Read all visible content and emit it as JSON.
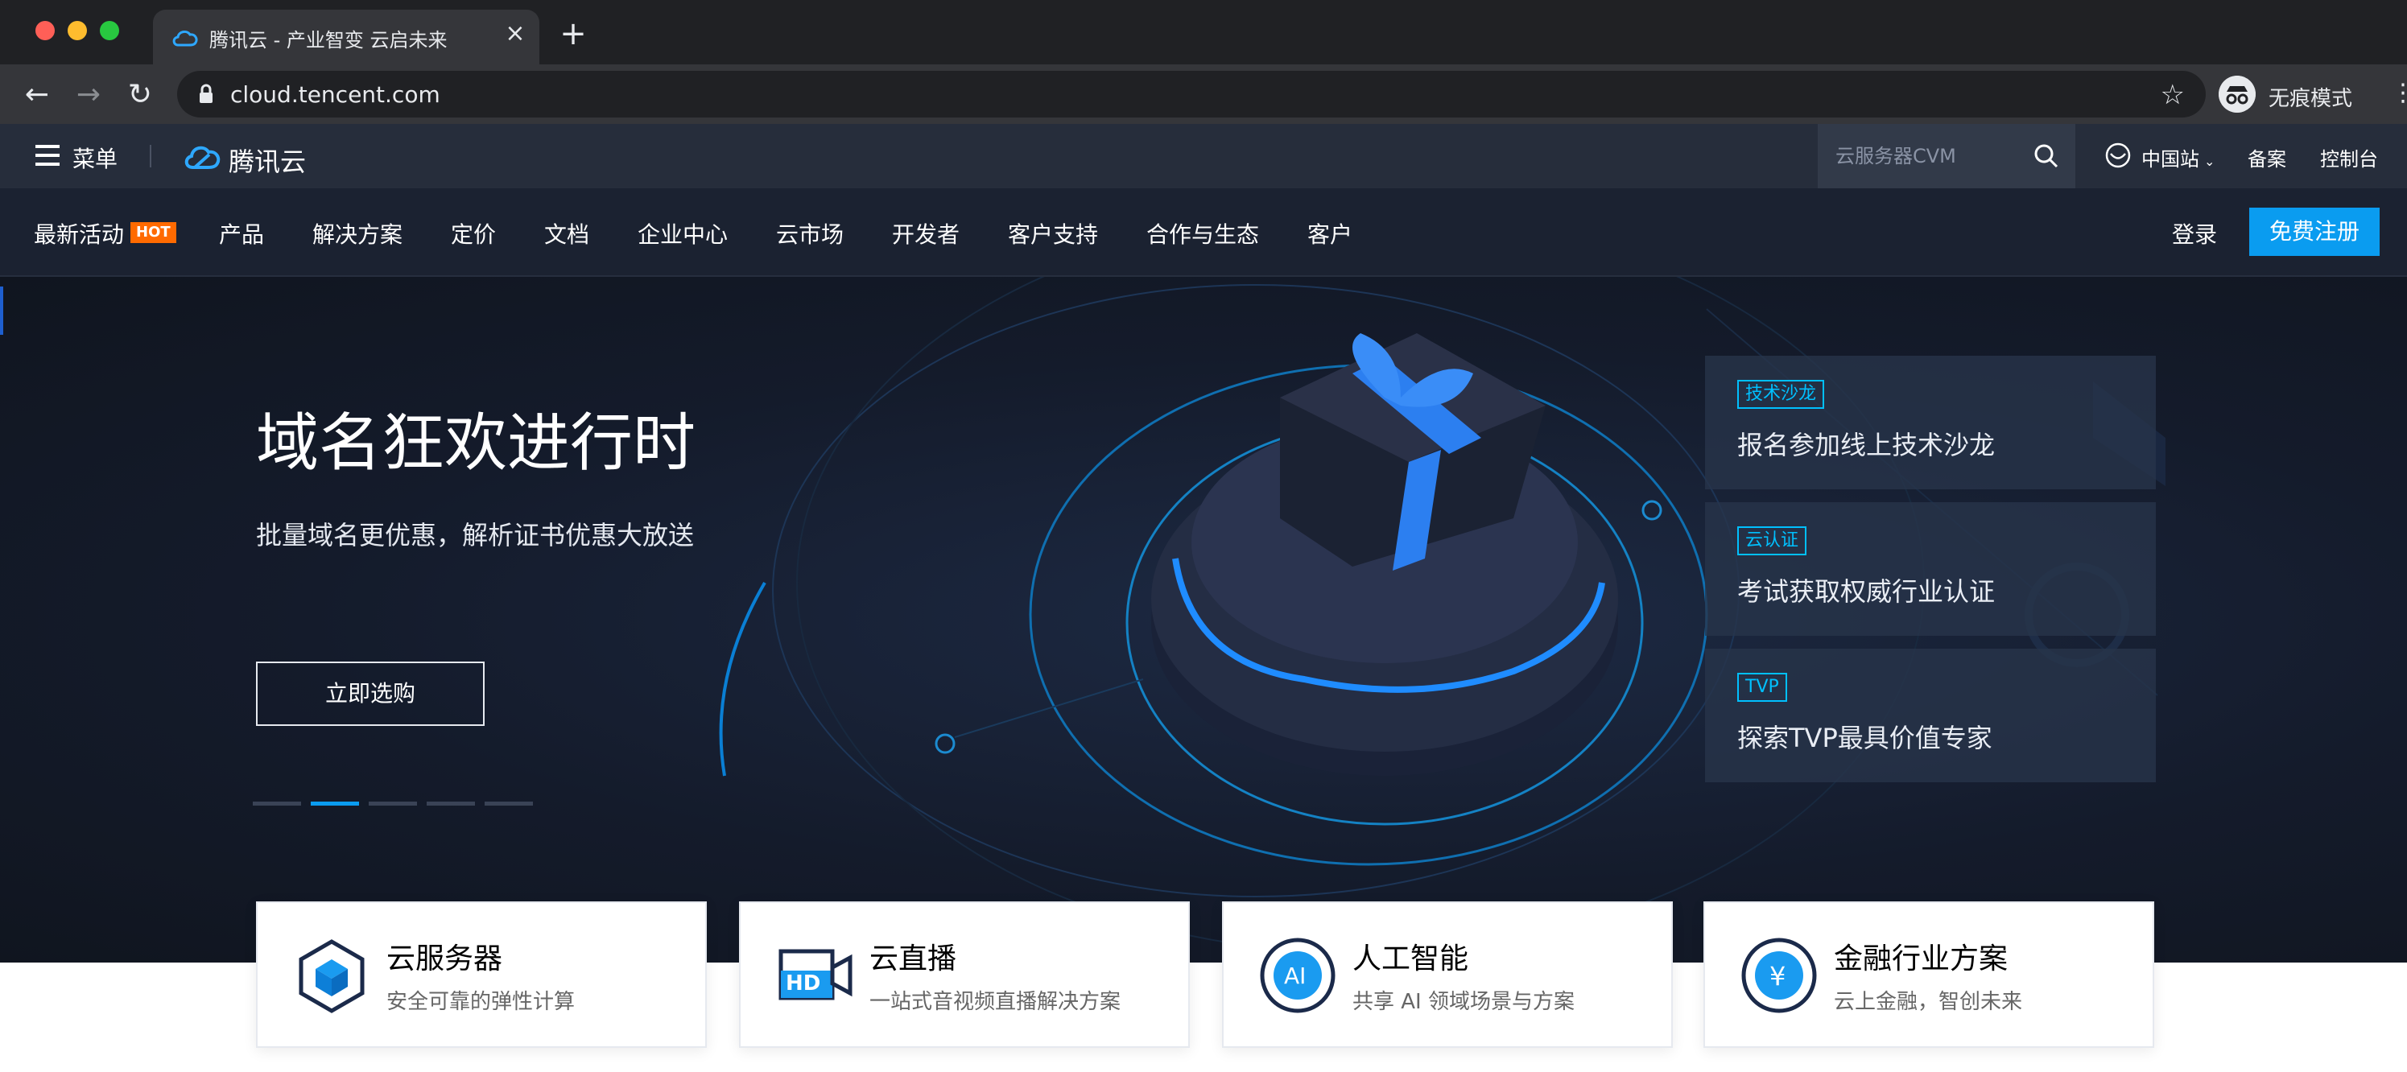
{
  "browser": {
    "tab_title": "腾讯云 - 产业智变 云启未来",
    "url": "cloud.tencent.com",
    "profile_label": "无痕模式",
    "new_tab_symbol": "+",
    "close_symbol": "×"
  },
  "header": {
    "menu_label": "菜单",
    "logo_text": "腾讯云",
    "search_placeholder": "云服务器CVM",
    "region_label": "中国站",
    "beian_label": "备案",
    "console_label": "控制台"
  },
  "nav": {
    "items": [
      "最新活动",
      "产品",
      "解决方案",
      "定价",
      "文档",
      "企业中心",
      "云市场",
      "开发者",
      "客户支持",
      "合作与生态",
      "客户"
    ],
    "hot_badge": "HOT",
    "login_label": "登录",
    "signup_label": "免费注册"
  },
  "hero": {
    "title": "域名狂欢进行时",
    "subtitle": "批量域名更优惠，解析证书优惠大放送",
    "cta_label": "立即选购",
    "carousel_total": 5,
    "carousel_active_index": 1
  },
  "side_cards": [
    {
      "tag": "技术沙龙",
      "text": "报名参加线上技术沙龙"
    },
    {
      "tag": "云认证",
      "text": "考试获取权威行业认证"
    },
    {
      "tag": "TVP",
      "text": "探索TVP最具价值专家"
    }
  ],
  "products": [
    {
      "title": "云服务器",
      "desc": "安全可靠的弹性计算",
      "icon": "cube-icon"
    },
    {
      "title": "云直播",
      "desc": "一站式音视频直播解决方案",
      "icon": "hd-camera-icon"
    },
    {
      "title": "人工智能",
      "desc": "共享 AI 领域场景与方案",
      "icon": "ai-icon"
    },
    {
      "title": "金融行业方案",
      "desc": "云上金融，智创未来",
      "icon": "yen-icon"
    }
  ],
  "colors": {
    "accent": "#0a9cf0",
    "hot": "#ff6a00",
    "tag": "#00c0ff",
    "header_bg": "#262d3b",
    "nav_bg": "#1b2231"
  }
}
